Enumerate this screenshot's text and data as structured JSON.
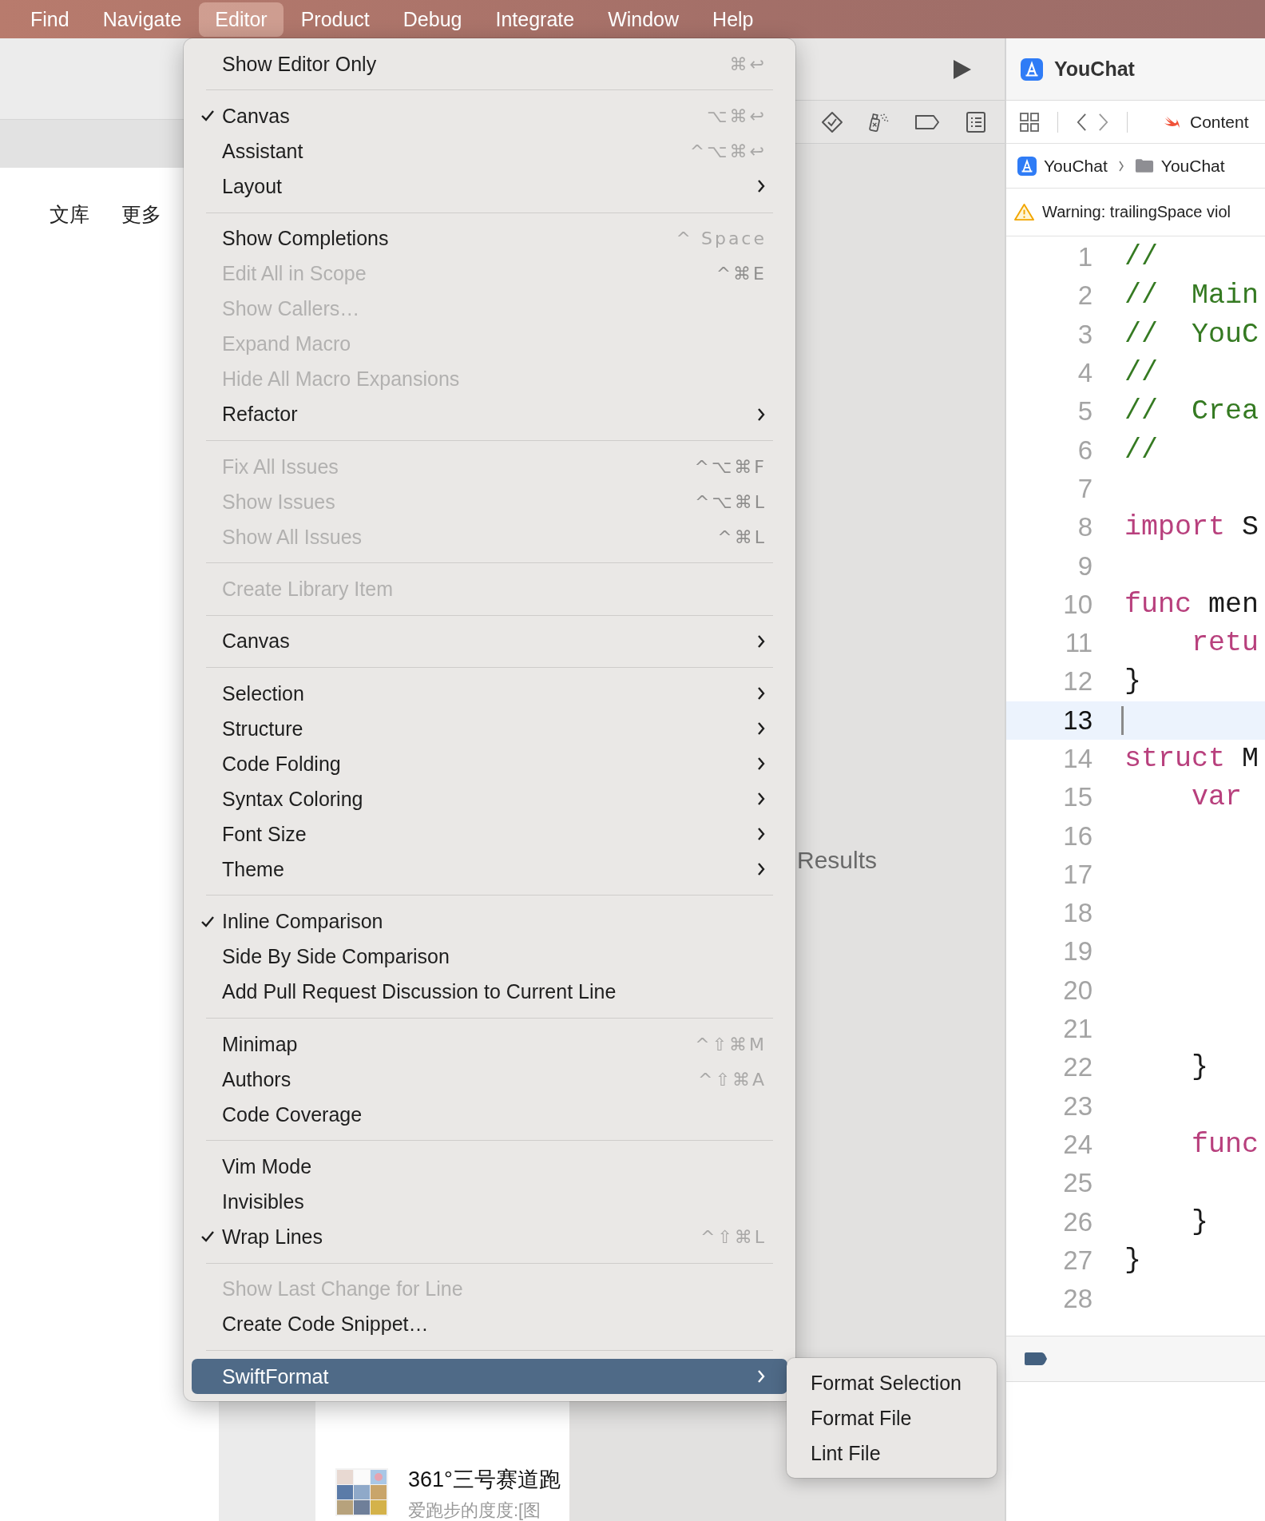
{
  "menu_bar": {
    "items": [
      {
        "label": "Find",
        "selected": false
      },
      {
        "label": "Navigate",
        "selected": false
      },
      {
        "label": "Editor",
        "selected": true
      },
      {
        "label": "Product",
        "selected": false
      },
      {
        "label": "Debug",
        "selected": false
      },
      {
        "label": "Integrate",
        "selected": false
      },
      {
        "label": "Window",
        "selected": false
      },
      {
        "label": "Help",
        "selected": false
      }
    ]
  },
  "left_window": {
    "tabs": [
      "文库",
      "更多"
    ],
    "list_item": {
      "title": "361°三号赛道跑",
      "subtitle": "爱跑步的度度:[图"
    }
  },
  "canvas": {
    "label": "Results"
  },
  "editor": {
    "project": "YouChat",
    "file_tab": "Content",
    "breadcrumb": [
      "YouChat",
      "YouChat"
    ],
    "warning": "Warning: trailingSpace viol",
    "lines": [
      {
        "number": "1",
        "selected": false,
        "tokens": [
          {
            "kind": "comment",
            "text": "//"
          }
        ]
      },
      {
        "number": "2",
        "selected": false,
        "tokens": [
          {
            "kind": "comment",
            "text": "//  Main"
          }
        ]
      },
      {
        "number": "3",
        "selected": false,
        "tokens": [
          {
            "kind": "comment",
            "text": "//  YouC"
          }
        ]
      },
      {
        "number": "4",
        "selected": false,
        "tokens": [
          {
            "kind": "comment",
            "text": "//"
          }
        ]
      },
      {
        "number": "5",
        "selected": false,
        "tokens": [
          {
            "kind": "comment",
            "text": "//  Crea"
          }
        ]
      },
      {
        "number": "6",
        "selected": false,
        "tokens": [
          {
            "kind": "comment",
            "text": "//"
          }
        ]
      },
      {
        "number": "7",
        "selected": false
      },
      {
        "number": "8",
        "selected": false,
        "tokens": [
          {
            "kind": "keyword",
            "text": "import"
          },
          {
            "kind": "plain",
            "text": " S"
          }
        ]
      },
      {
        "number": "9",
        "selected": false
      },
      {
        "number": "10",
        "selected": false,
        "tokens": [
          {
            "kind": "keyword",
            "text": "func"
          },
          {
            "kind": "plain",
            "text": " men"
          }
        ]
      },
      {
        "number": "11",
        "selected": false,
        "tokens": [
          {
            "kind": "keyword",
            "text": "    retu"
          }
        ]
      },
      {
        "number": "12",
        "selected": false,
        "tokens": [
          {
            "kind": "plain",
            "text": "}"
          }
        ]
      },
      {
        "number": "13",
        "selected": true
      },
      {
        "number": "14",
        "selected": false,
        "tokens": [
          {
            "kind": "keyword",
            "text": "struct"
          },
          {
            "kind": "plain",
            "text": " M"
          }
        ]
      },
      {
        "number": "15",
        "selected": false,
        "tokens": [
          {
            "kind": "keyword",
            "text": "    var"
          }
        ]
      },
      {
        "number": "16",
        "selected": false
      },
      {
        "number": "17",
        "selected": false
      },
      {
        "number": "18",
        "selected": false
      },
      {
        "number": "19",
        "selected": false
      },
      {
        "number": "20",
        "selected": false
      },
      {
        "number": "21",
        "selected": false
      },
      {
        "number": "22",
        "selected": false,
        "tokens": [
          {
            "kind": "plain",
            "text": "    }"
          }
        ]
      },
      {
        "number": "23",
        "selected": false
      },
      {
        "number": "24",
        "selected": false,
        "tokens": [
          {
            "kind": "keyword",
            "text": "    func"
          }
        ]
      },
      {
        "number": "25",
        "selected": false
      },
      {
        "number": "26",
        "selected": false,
        "tokens": [
          {
            "kind": "plain",
            "text": "    }"
          }
        ]
      },
      {
        "number": "27",
        "selected": false,
        "tokens": [
          {
            "kind": "plain",
            "text": "}"
          }
        ]
      },
      {
        "number": "28",
        "selected": false
      }
    ]
  },
  "menu": {
    "groups": [
      {
        "items": [
          {
            "label": "Show Editor Only",
            "shortcut": "⌘↩",
            "checked": false,
            "disabled": false,
            "submenu": false,
            "selected": false
          }
        ]
      },
      {
        "items": [
          {
            "label": "Canvas",
            "shortcut": "⌥⌘↩",
            "checked": true,
            "disabled": false,
            "submenu": false,
            "selected": false
          },
          {
            "label": "Assistant",
            "shortcut": "^⌥⌘↩",
            "checked": false,
            "disabled": false,
            "submenu": false,
            "selected": false
          },
          {
            "label": "Layout",
            "checked": false,
            "disabled": false,
            "submenu": true,
            "selected": false
          }
        ]
      },
      {
        "items": [
          {
            "label": "Show Completions",
            "shortcut": "^ Space",
            "checked": false,
            "disabled": false,
            "submenu": false,
            "selected": false
          },
          {
            "label": "Edit All in Scope",
            "shortcut": "^⌘E",
            "checked": false,
            "disabled": true,
            "submenu": false,
            "selected": false
          },
          {
            "label": "Show Callers…",
            "checked": false,
            "disabled": true,
            "submenu": false,
            "selected": false
          },
          {
            "label": "Expand Macro",
            "checked": false,
            "disabled": true,
            "submenu": false,
            "selected": false
          },
          {
            "label": "Hide All Macro Expansions",
            "checked": false,
            "disabled": true,
            "submenu": false,
            "selected": false
          },
          {
            "label": "Refactor",
            "checked": false,
            "disabled": false,
            "submenu": true,
            "selected": false
          }
        ]
      },
      {
        "items": [
          {
            "label": "Fix All Issues",
            "shortcut": "^⌥⌘F",
            "checked": false,
            "disabled": true,
            "submenu": false,
            "selected": false
          },
          {
            "label": "Show Issues",
            "shortcut": "^⌥⌘L",
            "checked": false,
            "disabled": true,
            "submenu": false,
            "selected": false
          },
          {
            "label": "Show All Issues",
            "shortcut": "^⌘L",
            "checked": false,
            "disabled": true,
            "submenu": false,
            "selected": false
          }
        ]
      },
      {
        "items": [
          {
            "label": "Create Library Item",
            "checked": false,
            "disabled": true,
            "submenu": false,
            "selected": false
          }
        ]
      },
      {
        "items": [
          {
            "label": "Canvas",
            "checked": false,
            "disabled": false,
            "submenu": true,
            "selected": false
          }
        ]
      },
      {
        "items": [
          {
            "label": "Selection",
            "checked": false,
            "disabled": false,
            "submenu": true,
            "selected": false
          },
          {
            "label": "Structure",
            "checked": false,
            "disabled": false,
            "submenu": true,
            "selected": false
          },
          {
            "label": "Code Folding",
            "checked": false,
            "disabled": false,
            "submenu": true,
            "selected": false
          },
          {
            "label": "Syntax Coloring",
            "checked": false,
            "disabled": false,
            "submenu": true,
            "selected": false
          },
          {
            "label": "Font Size",
            "checked": false,
            "disabled": false,
            "submenu": true,
            "selected": false
          },
          {
            "label": "Theme",
            "checked": false,
            "disabled": false,
            "submenu": true,
            "selected": false
          }
        ]
      },
      {
        "items": [
          {
            "label": "Inline Comparison",
            "checked": true,
            "disabled": false,
            "submenu": false,
            "selected": false
          },
          {
            "label": "Side By Side Comparison",
            "checked": false,
            "disabled": false,
            "submenu": false,
            "selected": false
          },
          {
            "label": "Add Pull Request Discussion to Current Line",
            "checked": false,
            "disabled": false,
            "submenu": false,
            "selected": false
          }
        ]
      },
      {
        "items": [
          {
            "label": "Minimap",
            "shortcut": "^⇧⌘M",
            "checked": false,
            "disabled": false,
            "submenu": false,
            "selected": false
          },
          {
            "label": "Authors",
            "shortcut": "^⇧⌘A",
            "checked": false,
            "disabled": false,
            "submenu": false,
            "selected": false
          },
          {
            "label": "Code Coverage",
            "checked": false,
            "disabled": false,
            "submenu": false,
            "selected": false
          }
        ]
      },
      {
        "items": [
          {
            "label": "Vim Mode",
            "checked": false,
            "disabled": false,
            "submenu": false,
            "selected": false
          },
          {
            "label": "Invisibles",
            "checked": false,
            "disabled": false,
            "submenu": false,
            "selected": false
          },
          {
            "label": "Wrap Lines",
            "shortcut": "^⇧⌘L",
            "checked": true,
            "disabled": false,
            "submenu": false,
            "selected": false
          }
        ]
      },
      {
        "items": [
          {
            "label": "Show Last Change for Line",
            "checked": false,
            "disabled": true,
            "submenu": false,
            "selected": false
          },
          {
            "label": "Create Code Snippet…",
            "checked": false,
            "disabled": false,
            "submenu": false,
            "selected": false
          }
        ]
      },
      {
        "items": [
          {
            "label": "SwiftFormat",
            "checked": false,
            "disabled": false,
            "submenu": true,
            "selected": true
          }
        ]
      }
    ]
  },
  "submenu": {
    "items": [
      "Format Selection",
      "Format File",
      "Lint File"
    ]
  }
}
